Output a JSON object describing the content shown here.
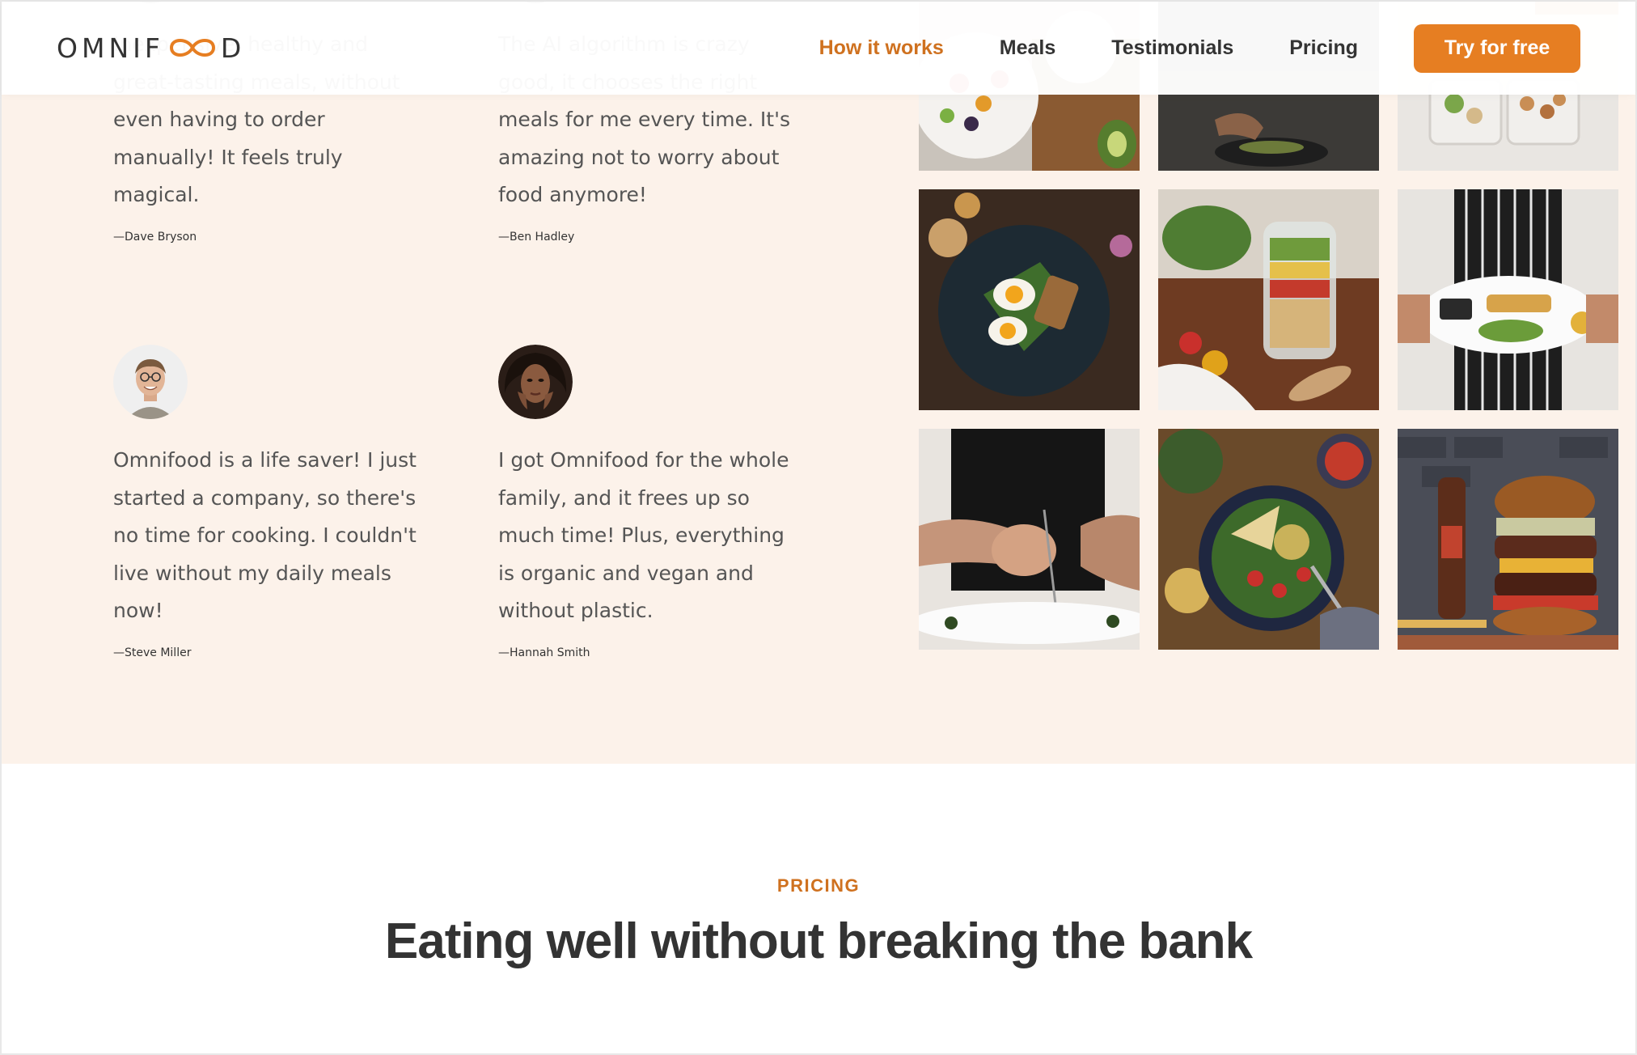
{
  "header": {
    "logo_text_left": "OMNIF",
    "logo_text_right": "D",
    "nav": [
      {
        "label": "How it works",
        "active": true
      },
      {
        "label": "Meals",
        "active": false
      },
      {
        "label": "Testimonials",
        "active": false
      },
      {
        "label": "Pricing",
        "active": false
      }
    ],
    "cta_label": "Try for free"
  },
  "testimonials": [
    {
      "quote": "Inexpensive, healthy and great-tasting meals, without even having to order manually! It feels truly magical.",
      "author": "—Dave Bryson"
    },
    {
      "quote": "The AI algorithm is crazy good, it chooses the right meals for me every time. It's amazing not to worry about food anymore!",
      "author": "—Ben Hadley"
    },
    {
      "quote": "Omnifood is a life saver! I just started a company, so there's no time for cooking. I couldn't live without my daily meals now!",
      "author": "—Steve Miller"
    },
    {
      "quote": "I got Omnifood for the whole family, and it frees up so much time! Plus, everything is organic and vegan and without plastic.",
      "author": "—Hannah Smith"
    }
  ],
  "gallery": [
    {
      "icon": "fruit-platter-photo"
    },
    {
      "icon": "chef-cooking-photo"
    },
    {
      "icon": "meal-prep-boxes-photo"
    },
    {
      "icon": "egg-toast-plate-photo"
    },
    {
      "icon": "salad-jar-photo"
    },
    {
      "icon": "plated-meal-photo"
    },
    {
      "icon": "chef-plating-photo"
    },
    {
      "icon": "vegetable-bowl-photo"
    },
    {
      "icon": "burger-photo"
    }
  ],
  "pricing": {
    "subheading": "PRICING",
    "heading": "Eating well without breaking the bank"
  },
  "colors": {
    "accent": "#e67e22",
    "accent_dark": "#cf711f",
    "section_bg": "#fcf2ea",
    "text": "#555555",
    "heading": "#333333"
  }
}
